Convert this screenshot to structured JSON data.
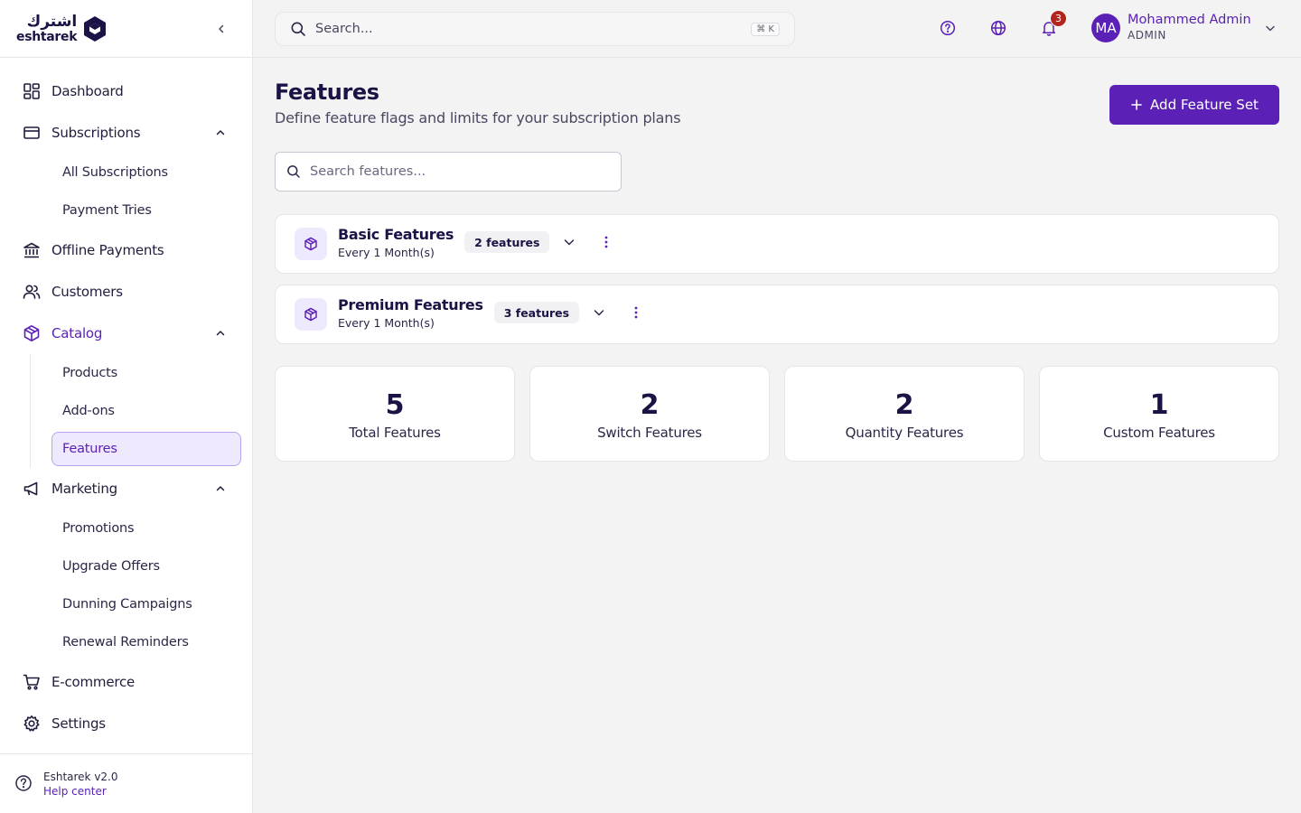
{
  "brand": {
    "logo_ar": "اشترك",
    "logo_en": "eshtarek"
  },
  "sidebar": {
    "dashboard": "Dashboard",
    "subscriptions": {
      "label": "Subscriptions",
      "items": [
        "All Subscriptions",
        "Payment Tries"
      ]
    },
    "offline_payments": "Offline Payments",
    "customers": "Customers",
    "catalog": {
      "label": "Catalog",
      "items": [
        "Products",
        "Add-ons",
        "Features"
      ]
    },
    "marketing": {
      "label": "Marketing",
      "items": [
        "Promotions",
        "Upgrade Offers",
        "Dunning Campaigns",
        "Renewal Reminders"
      ]
    },
    "ecommerce": "E-commerce",
    "settings": "Settings",
    "footer": {
      "version": "Eshtarek v2.0",
      "help": "Help center"
    }
  },
  "topbar": {
    "search_placeholder": "Search...",
    "shortcut": "⌘ K",
    "notification_count": "3",
    "user": {
      "initials": "MA",
      "name": "Mohammed Admin",
      "role": "ADMIN"
    }
  },
  "page": {
    "title": "Features",
    "subtitle": "Define feature flags and limits for your subscription plans",
    "add_button": "Add Feature Set",
    "search_placeholder": "Search features..."
  },
  "feature_sets": [
    {
      "name": "Basic Features",
      "period": "Every 1 Month(s)",
      "count": "2 features"
    },
    {
      "name": "Premium Features",
      "period": "Every 1 Month(s)",
      "count": "3 features"
    }
  ],
  "stats": [
    {
      "value": "5",
      "label": "Total Features"
    },
    {
      "value": "2",
      "label": "Switch Features"
    },
    {
      "value": "2",
      "label": "Quantity Features"
    },
    {
      "value": "1",
      "label": "Custom Features"
    }
  ],
  "colors": {
    "accent": "#5b21b6",
    "accent_soft": "#eee9fd",
    "badge": "#b3261e",
    "heading": "#1b1245"
  }
}
